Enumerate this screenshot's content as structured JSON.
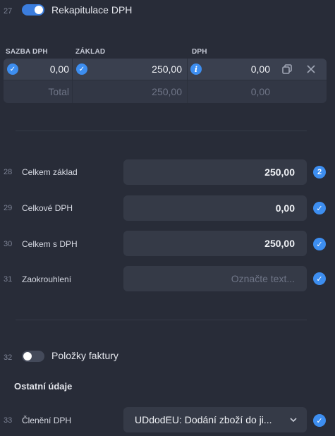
{
  "vat_recap": {
    "line_no": "27",
    "title": "Rekapitulace DPH",
    "toggle_on": true,
    "columns": {
      "rate": "SAZBA DPH",
      "base": "ZÁKLAD",
      "vat": "DPH"
    },
    "row": {
      "rate": "0,00",
      "base": "250,00",
      "vat": "0,00"
    },
    "total": {
      "label": "Total",
      "base": "250,00",
      "vat": "0,00"
    }
  },
  "summary_rows": [
    {
      "line_no": "28",
      "label": "Celkem základ",
      "value": "250,00",
      "placeholder": "",
      "status": "count",
      "status_text": "2"
    },
    {
      "line_no": "29",
      "label": "Celkové DPH",
      "value": "0,00",
      "placeholder": "",
      "status": "check"
    },
    {
      "line_no": "30",
      "label": "Celkem s DPH",
      "value": "250,00",
      "placeholder": "",
      "status": "check"
    },
    {
      "line_no": "31",
      "label": "Zaokrouhlení",
      "value": "",
      "placeholder": "Označte text...",
      "status": "check"
    }
  ],
  "invoice_items": {
    "line_no": "32",
    "title": "Položky faktury",
    "toggle_on": false
  },
  "other_section": {
    "title": "Ostatní údaje"
  },
  "vat_split": {
    "line_no": "33",
    "label": "Členění DPH",
    "value": "UDdodEU: Dodání zboží do ji..."
  },
  "colors": {
    "background": "#282c38",
    "field": "#353a47",
    "accent": "#3d8ef0"
  },
  "icons": {
    "check": "check-circle-icon",
    "info": "info-circle-icon",
    "copy": "copy-icon",
    "close": "close-icon",
    "dropdown": "chevron-down-icon"
  }
}
